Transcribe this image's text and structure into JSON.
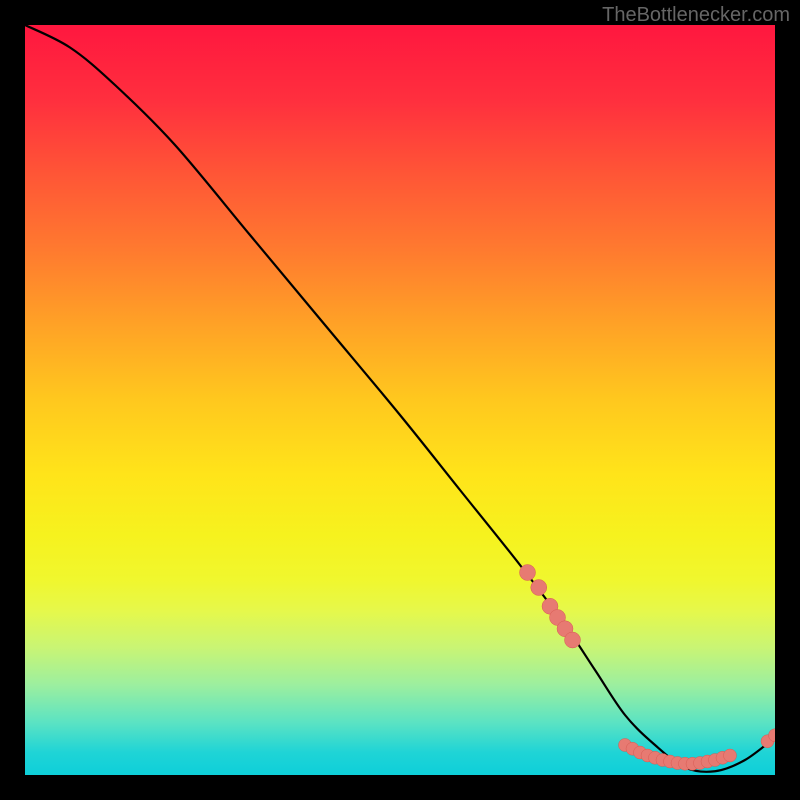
{
  "attribution": "TheBottlenecker.com",
  "chart_data": {
    "type": "line",
    "title": "",
    "xlabel": "",
    "ylabel": "",
    "xlim": [
      0,
      100
    ],
    "ylim": [
      0,
      100
    ],
    "series": [
      {
        "name": "curve",
        "x": [
          0,
          6,
          12,
          20,
          30,
          40,
          50,
          58,
          66,
          72,
          76,
          80,
          84,
          88,
          92,
          96,
          100
        ],
        "y": [
          100,
          97,
          92,
          84,
          72,
          60,
          48,
          38,
          28,
          20,
          14,
          8,
          4,
          1,
          0.5,
          2,
          5
        ]
      }
    ],
    "markers": [
      {
        "name": "cluster-upper",
        "points": [
          {
            "x": 67,
            "y": 27
          },
          {
            "x": 68.5,
            "y": 25
          },
          {
            "x": 70,
            "y": 22.5
          },
          {
            "x": 71,
            "y": 21
          },
          {
            "x": 72,
            "y": 19.5
          },
          {
            "x": 73,
            "y": 18
          }
        ]
      },
      {
        "name": "cluster-bottom",
        "points": [
          {
            "x": 80,
            "y": 4.0
          },
          {
            "x": 81,
            "y": 3.5
          },
          {
            "x": 82,
            "y": 3.0
          },
          {
            "x": 83,
            "y": 2.6
          },
          {
            "x": 84,
            "y": 2.3
          },
          {
            "x": 85,
            "y": 2.0
          },
          {
            "x": 86,
            "y": 1.8
          },
          {
            "x": 87,
            "y": 1.6
          },
          {
            "x": 88,
            "y": 1.5
          },
          {
            "x": 89,
            "y": 1.5
          },
          {
            "x": 90,
            "y": 1.6
          },
          {
            "x": 91,
            "y": 1.8
          },
          {
            "x": 92,
            "y": 2.0
          },
          {
            "x": 93,
            "y": 2.3
          },
          {
            "x": 94,
            "y": 2.6
          }
        ]
      },
      {
        "name": "cluster-right",
        "points": [
          {
            "x": 99,
            "y": 4.5
          },
          {
            "x": 100,
            "y": 5.3
          }
        ]
      }
    ],
    "colors": {
      "curve": "#000000",
      "marker_fill": "#e77a72",
      "marker_stroke": "#d85a52"
    }
  }
}
